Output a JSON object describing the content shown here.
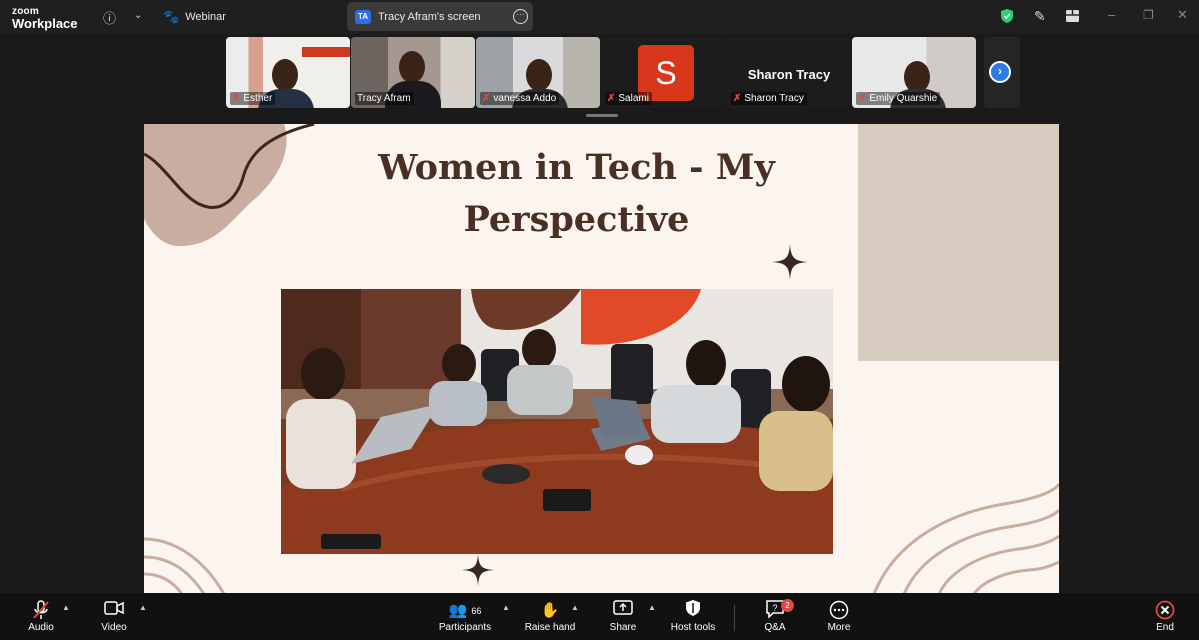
{
  "app": {
    "brand_top": "zoom",
    "brand_bottom": "Workplace",
    "mode": "Webinar"
  },
  "screen_share": {
    "badge": "TA",
    "label": "Tracy Afram's screen"
  },
  "participants_strip": [
    {
      "name": "Esther",
      "muted": true,
      "type": "video"
    },
    {
      "name": "Tracy Afram",
      "muted": false,
      "type": "video",
      "active": true
    },
    {
      "name": "vanessa Addo",
      "muted": true,
      "type": "video"
    },
    {
      "name": "Salami",
      "muted": true,
      "type": "avatar",
      "initial": "S"
    },
    {
      "name": "Sharon Tracy",
      "muted": true,
      "type": "name-card"
    },
    {
      "name": "Emily Quarshie",
      "muted": true,
      "type": "video"
    }
  ],
  "slide": {
    "title": "Women in Tech - My Perspective"
  },
  "toolbar": {
    "audio": "Audio",
    "video": "Video",
    "participants": "Participants",
    "participants_count": "66",
    "raise_hand": "Raise hand",
    "share": "Share",
    "host_tools": "Host tools",
    "qa": "Q&A",
    "qa_badge": "2",
    "more": "More",
    "end": "End"
  },
  "colors": {
    "accent_green": "#27d07a",
    "brand_blue": "#2b7ae6",
    "end_red": "#e0483e",
    "slide_text": "#4a2f25"
  }
}
